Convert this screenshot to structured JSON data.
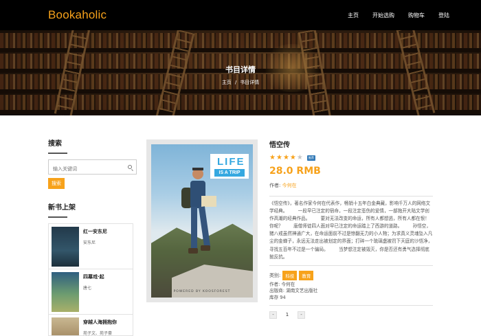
{
  "brand": "Bookaholic",
  "nav": [
    "主页",
    "开始选购",
    "购物车",
    "登陆"
  ],
  "hero": {
    "title": "书目详情",
    "breadcrumb": {
      "home": "主页",
      "separator": "/",
      "current": "书目详情"
    }
  },
  "sidebar": {
    "search_heading": "搜索",
    "search_placeholder": "输入关键词",
    "search_button": "搜索",
    "new_heading": "新书上架",
    "new_books": [
      {
        "title": "红一安东尼",
        "author": "安东尼",
        "cover_color": "#2d4a5a"
      },
      {
        "title": "四幕戏·起",
        "author": "唐七",
        "cover_color": "#3a6a8a"
      },
      {
        "title": "穿越人海拥抱你",
        "author": "苑子文、苑子豪",
        "cover_color": "#c7b79a"
      }
    ]
  },
  "cover": {
    "line1": "LIFE",
    "line2": "IS A TRIP",
    "powered": "POWERED BY KOOSFOREST"
  },
  "book": {
    "title": "悟空传",
    "rating": 4,
    "rating_max": 5,
    "badge": "推荐",
    "price": "28.0 RMB",
    "author_label": "作者:",
    "author": "今何在",
    "description": "《悟空传》，著名作家今何在代表作，畅销十五年白金典藏，影响千万人的网络文学经典。 　　一段早已注定的宿命，一段注定悲伤的爱情，一部拖开大陆文学创作高潮的经典作品。 　　要对无法改变的命运，所有人都想逃，所有人都在恨！你呢？ 　　唐僧师徒四人面对早已注定的命运踏上了西游的道路。 　　孙悟空，猪八戒虽然神通广大，在命运面前不过是惊翻无力的小人物；为求真义灵魂坠入凡尘的金蝉子，永远无法走出被划定的界面；打碎一个琉璃盏被罚下天庭的沙悟净，寻找五百年不过是一个骗局。 　　当梦想注定被毁灭，你是否还有勇气选择彻底抛反抗。",
    "category_label": "类别:",
    "categories": [
      "科技",
      "教育"
    ],
    "meta_author": "作者: 今何在",
    "publisher": "出版商: 湖南文艺出版社",
    "stock": "库存 94",
    "qty_minus": "-",
    "qty_value": "1",
    "qty_plus": "-"
  }
}
